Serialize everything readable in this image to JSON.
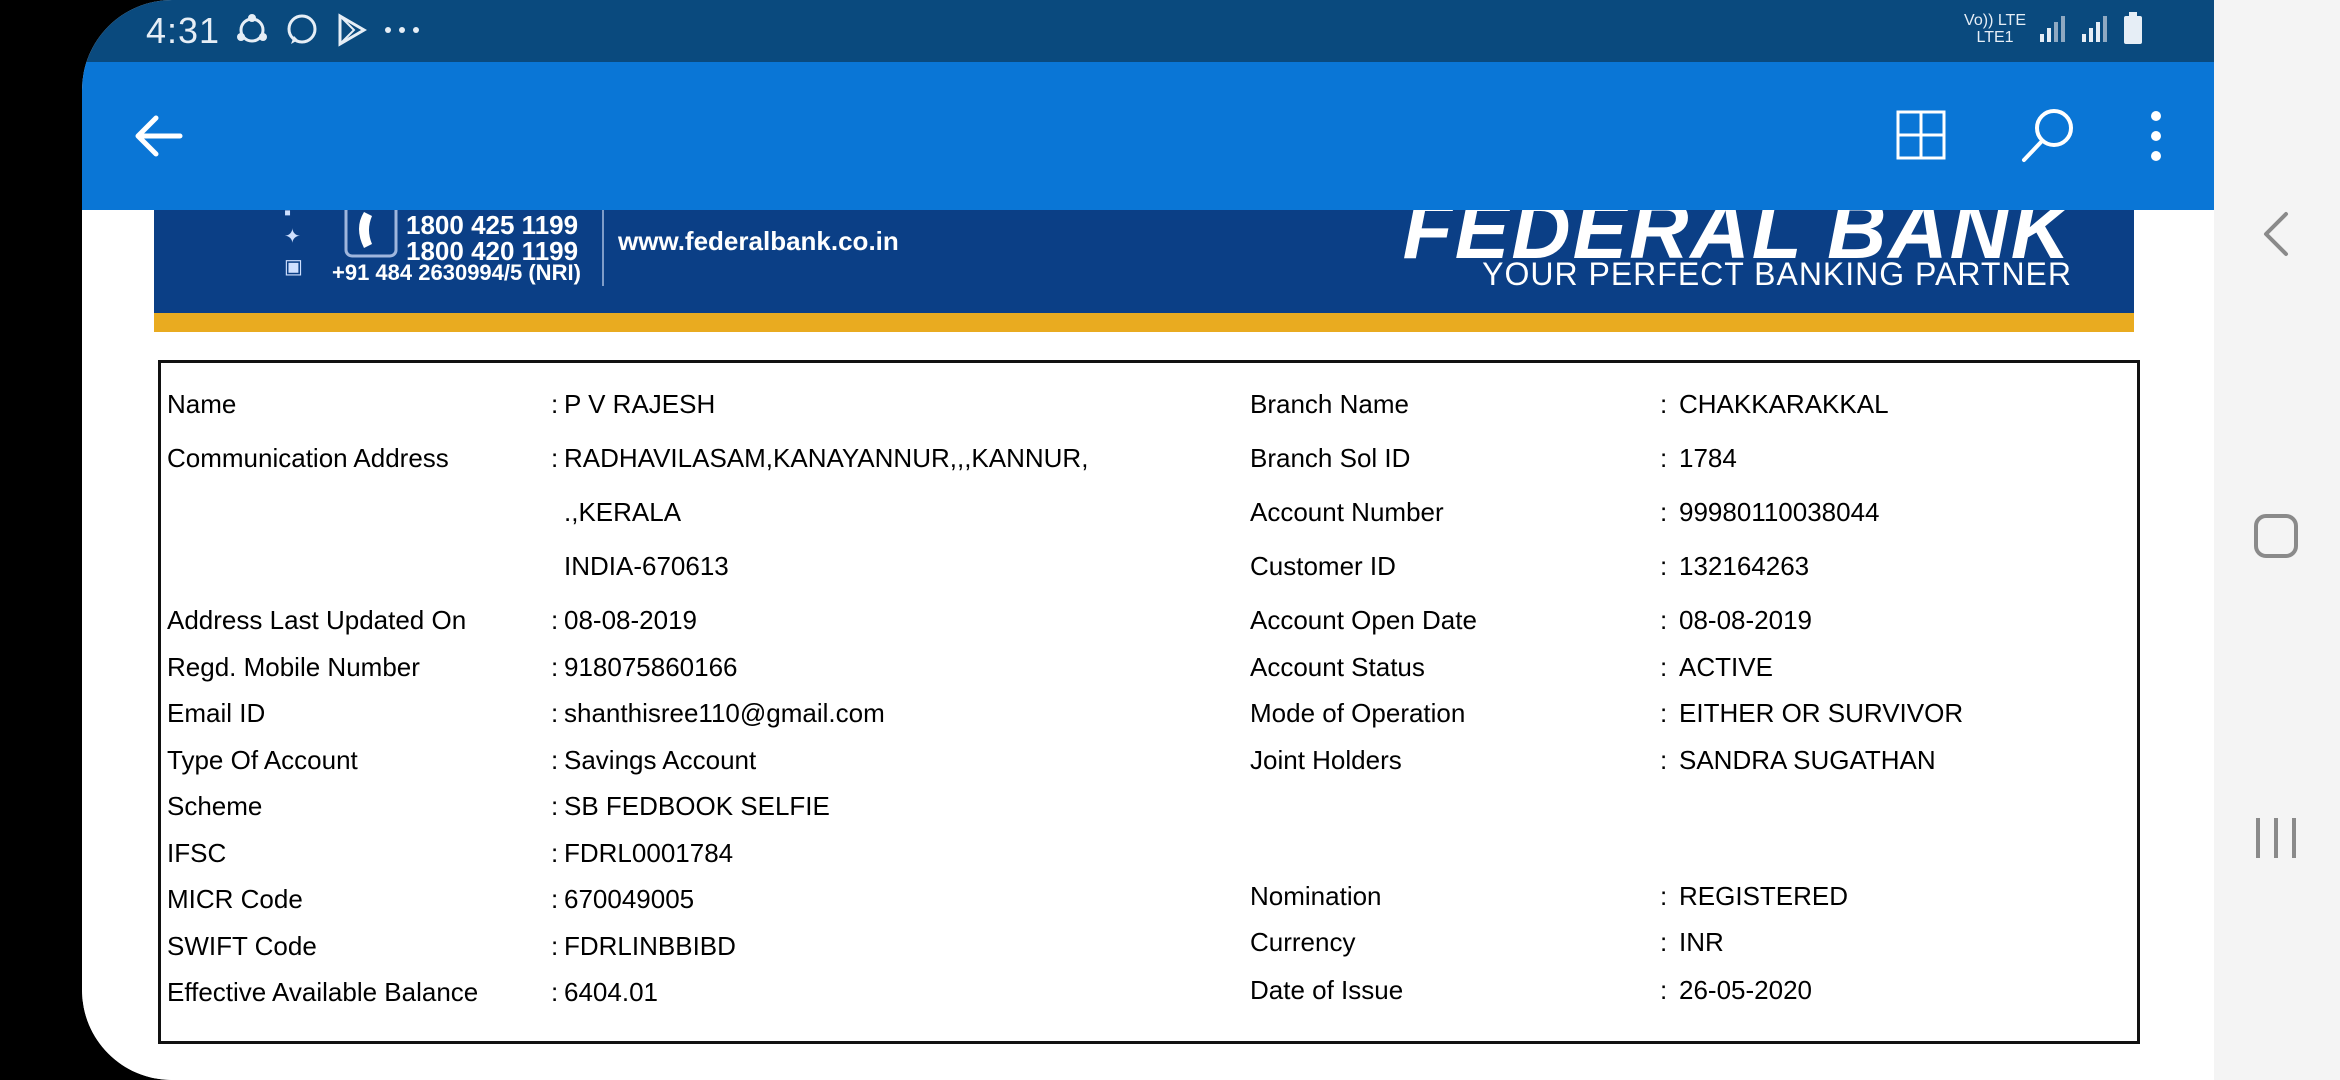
{
  "status": {
    "time": "4:31",
    "network_label_1": "Vo)) LTE",
    "network_label_2": "LTE1"
  },
  "appbar": {
    "back_icon": "arrow-left-icon",
    "grid_icon": "grid-icon",
    "search_icon": "search-icon",
    "more_icon": "more-vertical-icon"
  },
  "banner": {
    "phone_1": "1800 425 1199",
    "phone_2": "1800 420 1199",
    "phone_nri": "+91 484 2630994/5 (NRI)",
    "website": "www.federalbank.co.in",
    "brand": "FEDERAL BANK",
    "tagline": "YOUR PERFECT BANKING PARTNER"
  },
  "left_fields": [
    {
      "label": "Name",
      "value": "P V RAJESH"
    },
    {
      "label": "Communication Address",
      "value": "RADHAVILASAM,KANAYANNUR,,,KANNUR,"
    },
    {
      "label": "",
      "value": ".,KERALA"
    },
    {
      "label": "",
      "value": "INDIA-670613"
    },
    {
      "label": "Address Last Updated On",
      "value": "08-08-2019"
    },
    {
      "label": "Regd. Mobile Number",
      "value": "918075860166"
    },
    {
      "label": "Email ID",
      "value": "shanthisree110@gmail.com"
    },
    {
      "label": "Type Of Account",
      "value": "Savings Account"
    },
    {
      "label": "Scheme",
      "value": "SB FEDBOOK SELFIE"
    },
    {
      "label": "IFSC",
      "value": "FDRL0001784"
    },
    {
      "label": "MICR Code",
      "value": "670049005"
    },
    {
      "label": "SWIFT Code",
      "value": "FDRLINBBIBD"
    },
    {
      "label": "Effective Available Balance",
      "value": "6404.01"
    }
  ],
  "right_fields": [
    {
      "label": "Branch Name",
      "value": "CHAKKARAKKAL"
    },
    {
      "label": "Branch Sol ID",
      "value": "1784"
    },
    {
      "label": "Account Number",
      "value": "99980110038044"
    },
    {
      "label": "Customer ID",
      "value": "132164263"
    },
    {
      "label": "Account Open Date",
      "value": "08-08-2019"
    },
    {
      "label": "Account Status",
      "value": "ACTIVE"
    },
    {
      "label": "Mode of Operation",
      "value": "EITHER OR SURVIVOR"
    },
    {
      "label": "Joint Holders",
      "value": "SANDRA SUGATHAN"
    },
    {
      "label": "Nomination",
      "value": "REGISTERED"
    },
    {
      "label": "Currency",
      "value": "INR"
    },
    {
      "label": "Date of Issue",
      "value": "26-05-2020"
    }
  ],
  "navbar": {
    "back_icon": "nav-back-icon",
    "home_icon": "nav-home-icon",
    "recents_icon": "nav-recents-icon"
  }
}
